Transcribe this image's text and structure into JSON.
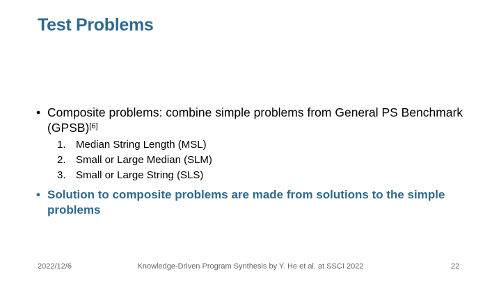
{
  "slide": {
    "title": "Test Problems",
    "bullets": [
      {
        "text": "Composite problems: combine simple problems from General PS Benchmark (GPSB)",
        "citation": "[6]",
        "subitems": [
          {
            "number": "1.",
            "text": "Median String Length (MSL)"
          },
          {
            "number": "2.",
            "text": "Small or Large Median (SLM)"
          },
          {
            "number": "3.",
            "text": "Small or Large String (SLS)"
          }
        ]
      },
      {
        "text": "Solution to composite problems are made from solutions to the simple problems"
      }
    ],
    "bullet_glyph": "•",
    "footer": {
      "date": "2022/12/6",
      "center": "Knowledge-Driven Program Synthesis by Y. He et al. at SSCI 2022",
      "page_number": "22"
    }
  },
  "colors": {
    "accent": "#2e6a8e",
    "text": "#000000",
    "footer": "#666666",
    "background": "#ffffff"
  }
}
